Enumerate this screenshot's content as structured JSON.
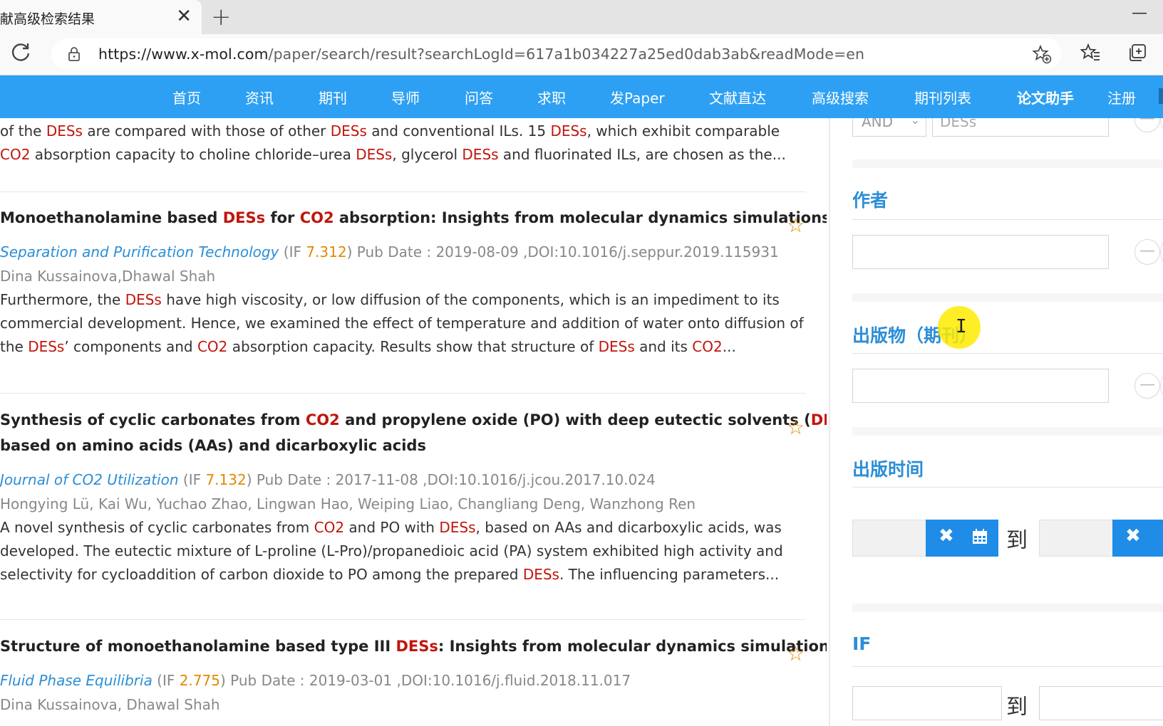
{
  "browser": {
    "tab_title": "献高级检索结果",
    "tab_close": "✕",
    "new_tab": "+",
    "minimize": "—",
    "url_host": "https://www.x-mol.com",
    "url_path": "/paper/search/result?searchLogId=617a1b034227a25ed0dab3ab&readMode=en"
  },
  "nav": {
    "items": [
      "首页",
      "资讯",
      "期刊",
      "导师",
      "问答",
      "求职",
      "发Paper",
      "文献直达",
      "高级搜索",
      "期刊列表",
      "论文助手",
      "注册"
    ]
  },
  "top_snippet": {
    "line1": [
      "of the ",
      "DESs",
      " are compared with those of other ",
      "DESs",
      " and conventional ILs. 15 ",
      "DESs",
      ", which exhibit comparable"
    ],
    "line2": [
      "CO2",
      " absorption capacity to choline chloride–urea ",
      "DESs",
      ", glycerol ",
      "DESs",
      " and fluorinated ILs, are chosen as the..."
    ]
  },
  "results": [
    {
      "title_parts": [
        "Monoethanolamine based ",
        "DESs",
        " for ",
        "CO2",
        " absorption: Insights from molecular dynamics simulations"
      ],
      "journal": "Separation and Purification Technology",
      "if_prefix": " (IF ",
      "if_value": "7.312",
      "meta_rest": ") Pub Date : 2019-08-09 ,DOI:10.1016/j.seppur.2019.115931",
      "authors": "Dina Kussainova,Dhawal Shah",
      "abstract": [
        [
          "Furthermore, the ",
          "DESs",
          " have high viscosity, or low diffusion of the components, which is an impediment to its"
        ],
        [
          "commercial development. Hence, we examined the effect of temperature and addition of water onto diffusion of"
        ],
        [
          "the ",
          "DESs",
          "’   components and ",
          "CO2",
          " absorption capacity. Results show that structure of ",
          "DESs",
          " and its ",
          "CO2",
          "..."
        ]
      ]
    },
    {
      "title_parts": [
        "Synthesis of cyclic carbonates from ",
        "CO2",
        " and propylene oxide (PO) with deep eutectic solvents (",
        "DESs",
        ")"
      ],
      "title_line2": "based on amino acids (AAs) and dicarboxylic acids",
      "journal": "Journal of CO2 Utilization",
      "if_prefix": " (IF ",
      "if_value": "7.132",
      "meta_rest": ") Pub Date : 2017-11-08 ,DOI:10.1016/j.jcou.2017.10.024",
      "authors": "Hongying Lü, Kai Wu, Yuchao Zhao, Lingwan Hao, Weiping Liao, Changliang Deng, Wanzhong Ren",
      "abstract": [
        [
          "A novel synthesis of cyclic carbonates from ",
          "CO2",
          " and PO with ",
          "DESs",
          ", based on AAs and dicarboxylic acids, was"
        ],
        [
          "developed. The eutectic mixture of L-proline (L-Pro)/propanedioic acid (PA) system exhibited high activity and"
        ],
        [
          "selectivity for cycloaddition of carbon dioxide to PO among the prepared ",
          "DESs",
          ". The influencing parameters..."
        ]
      ]
    },
    {
      "title_parts": [
        "Structure of monoethanolamine based type III ",
        "DESs",
        ": Insights from molecular dynamics simulations"
      ],
      "journal": "Fluid Phase Equilibria",
      "if_prefix": " (IF ",
      "if_value": "2.775",
      "meta_rest": ") Pub Date : 2019-03-01 ,DOI:10.1016/j.fluid.2018.11.017",
      "authors": "Dina Kussainova, Dhawal Shah"
    }
  ],
  "panel": {
    "and_value": "AND",
    "des_value": "DESs",
    "author_label": "作者",
    "publication_label": "出版物（期刊）",
    "pubtime_label": "出版时间",
    "to_label": "到",
    "if_label": "IF",
    "minus": "—",
    "clear_glyph": "✖"
  },
  "colors": {
    "nav_bg": "#2ea0f3",
    "highlight": "#c0160c",
    "link": "#2c8ed6",
    "if_value": "#e08a00"
  }
}
